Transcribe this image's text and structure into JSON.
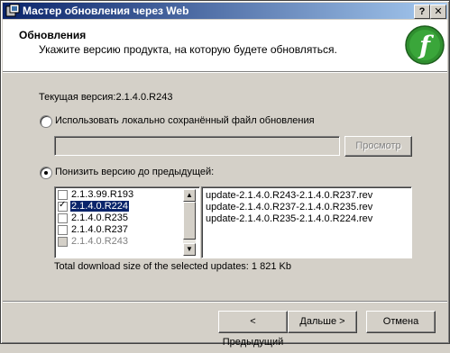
{
  "window": {
    "title": "Мастер обновления через Web",
    "help_label": "?",
    "close_label": "✕"
  },
  "header": {
    "title": "Обновления",
    "subtitle": "Укажите версию продукта, на которую будете обновляться.",
    "logo_letter": "f"
  },
  "current_version": "Текущая версия:2.1.4.0.R243",
  "option_local": {
    "label": "Использовать локально сохранённый файл обновления",
    "selected": false,
    "path_value": "",
    "browse_label": "Просмотр"
  },
  "option_downgrade": {
    "label": "Понизить версию до предыдущей:",
    "selected": true
  },
  "versions": [
    {
      "label": "2.1.3.99.R193",
      "checked": false,
      "selected": false,
      "disabled": false
    },
    {
      "label": "2.1.4.0.R224",
      "checked": true,
      "selected": true,
      "disabled": false
    },
    {
      "label": "2.1.4.0.R235",
      "checked": false,
      "selected": false,
      "disabled": false
    },
    {
      "label": "2.1.4.0.R237",
      "checked": false,
      "selected": false,
      "disabled": false
    },
    {
      "label": "2.1.4.0.R243",
      "checked": false,
      "selected": false,
      "disabled": true
    }
  ],
  "updates": [
    "update-2.1.4.0.R243-2.1.4.0.R237.rev",
    "update-2.1.4.0.R237-2.1.4.0.R235.rev",
    "update-2.1.4.0.R235-2.1.4.0.R224.rev"
  ],
  "download_size": "Total download size of the selected updates: 1 821 Kb",
  "buttons": {
    "back": "< Предыдущий",
    "next": "Дальше >",
    "cancel": "Отмена"
  }
}
